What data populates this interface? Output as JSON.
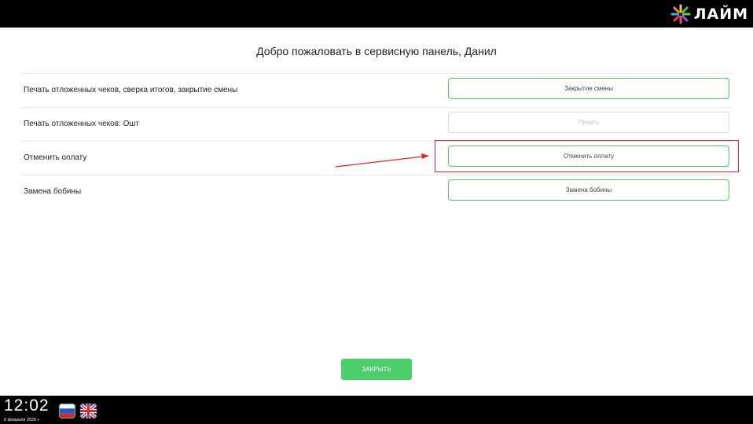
{
  "header": {
    "logo_text": "ЛАЙМ",
    "logo_icon": "lime-star-icon"
  },
  "main": {
    "title": "Добро пожаловать в сервисную панель, Данил",
    "rows": [
      {
        "label": "Печать отложенных чеков, сверка итогов, закрытие смены",
        "button": "Закрытие смены",
        "enabled": true
      },
      {
        "label": "Печать отложенных чеков: Ошт",
        "button": "Печать",
        "enabled": false
      },
      {
        "label": "Отменить оплату",
        "button": "Отменить оплату",
        "enabled": true
      },
      {
        "label": "Замена бобины",
        "button": "Замена бобины",
        "enabled": true
      }
    ],
    "close_label": "ЗАКРЫТЬ"
  },
  "footer": {
    "time": "12:02",
    "date": "6 февраля 2026 г.",
    "languages": [
      "ru-flag-icon",
      "uk-flag-icon"
    ]
  },
  "colors": {
    "accent_green": "#4cce6a",
    "highlight_red": "#e0262c",
    "bar_black": "#000000"
  }
}
